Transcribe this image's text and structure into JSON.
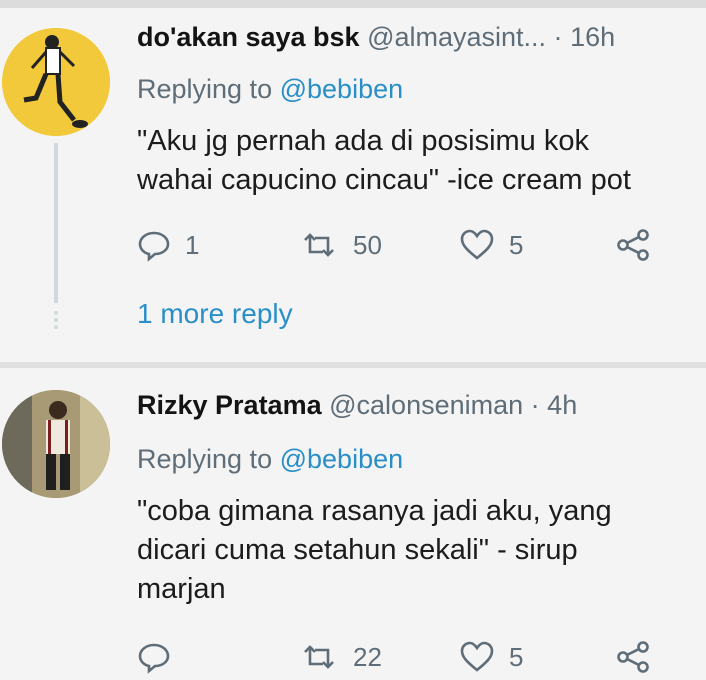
{
  "tweets": [
    {
      "name": "do'akan saya bsk",
      "handle": "@almayasint...",
      "dot": "·",
      "time": "16h",
      "replying_prefix": "Replying to",
      "replying_mention": "@bebiben",
      "text_lines": [
        "\"Aku jg pernah ada di posisimu kok",
        "wahai capucino cincau\" -ice cream pot"
      ],
      "counts": {
        "reply": "1",
        "retweet": "50",
        "like": "5"
      },
      "more_replies": "1 more reply"
    },
    {
      "name": "Rizky Pratama",
      "handle": "@calonseniman",
      "dot": "·",
      "time": "4h",
      "replying_prefix": "Replying to",
      "replying_mention": "@bebiben",
      "text_lines": [
        "\"coba gimana rasanya jadi aku, yang",
        "dicari cuma setahun sekali\" - sirup",
        "marjan"
      ],
      "counts": {
        "reply": "",
        "retweet": "22",
        "like": "5"
      }
    }
  ],
  "colors": {
    "link": "#2a8fc7",
    "muted": "#5f6d78",
    "avatar1_bg": "#f2c93b"
  },
  "icons": [
    "reply-icon",
    "retweet-icon",
    "like-icon",
    "share-icon"
  ]
}
